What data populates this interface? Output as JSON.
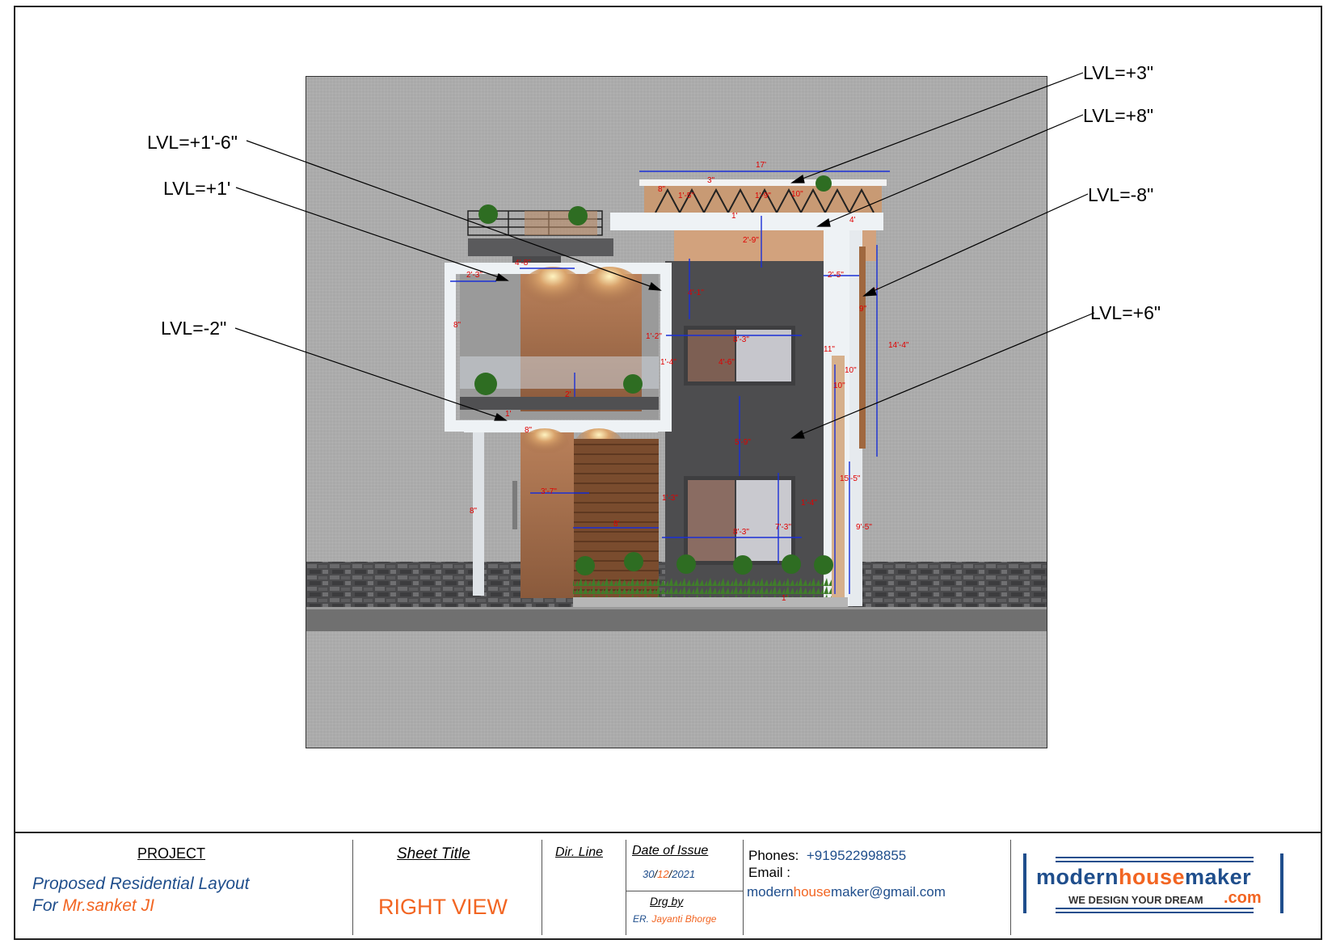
{
  "levels": [
    {
      "id": "lvl-plus-3",
      "label": "LVL=+3\""
    },
    {
      "id": "lvl-plus-8",
      "label": "LVL=+8\""
    },
    {
      "id": "lvl-plus-1-6",
      "label": "LVL=+1'-6\""
    },
    {
      "id": "lvl-plus-1",
      "label": "LVL=+1'"
    },
    {
      "id": "lvl-minus-8",
      "label": "LVL=-8\""
    },
    {
      "id": "lvl-plus-6",
      "label": "LVL=+6\""
    },
    {
      "id": "lvl-minus-2",
      "label": "LVL=-2\""
    }
  ],
  "dimensions": [
    "17'",
    "3\"",
    "8\"",
    "1'-5\"",
    "1'-9\"",
    "10\"",
    "1'",
    "4'",
    "2'",
    "2'-9\"",
    "1'",
    "4'-8\"",
    "8\"",
    "2'-3\"",
    "4'-1\"",
    "2'-5\"",
    "1'",
    "9\"",
    "14'-4\"",
    "8\"",
    "1'-2\"",
    "8'-3\"",
    "1'-4\"",
    "4'-6\"",
    "11\"",
    "10\"",
    "10\"",
    "2'",
    "1'",
    "8\"",
    "5'-9\"",
    "15'-5\"",
    "3'-7\"",
    "1'-3\"",
    "1'-4\"",
    "8\"",
    "9'-5\"",
    "8'",
    "8'-3\"",
    "7'-3\"",
    "1'"
  ],
  "colors": {
    "dimension": "#e00000",
    "dimension_line": "#1a2fd6",
    "accent_orange": "#f26522",
    "project_blue": "#1f4e8c"
  },
  "titleblock": {
    "project_heading": "PROJECT",
    "project_line1": "Proposed Residential Layout",
    "project_line2_prefix": "For ",
    "project_line2_name": "Mr.sanket  JI",
    "sheet_title_heading": "Sheet Title",
    "sheet_title": "RIGHT VIEW",
    "dir_line": "Dir. Line",
    "date_heading": "Date of Issue",
    "date_day": "30",
    "date_month": "12",
    "date_year": "2021",
    "date_sep": "/",
    "drg_by_heading": "Drg by",
    "drg_by_prefix": "ER.",
    "drg_by_name": "Jayanti Bhorge",
    "phones_label": "Phones:",
    "phones_value": "+919522998855",
    "email_label": "Email :",
    "email_part1": "modern",
    "email_part2": "house",
    "email_part3": "maker@gmail.com",
    "logo_part1": "modern",
    "logo_part2": "house",
    "logo_part3": "maker",
    "logo_tagline": "WE DESIGN YOUR DREAM",
    "logo_dotcom": ".com"
  }
}
